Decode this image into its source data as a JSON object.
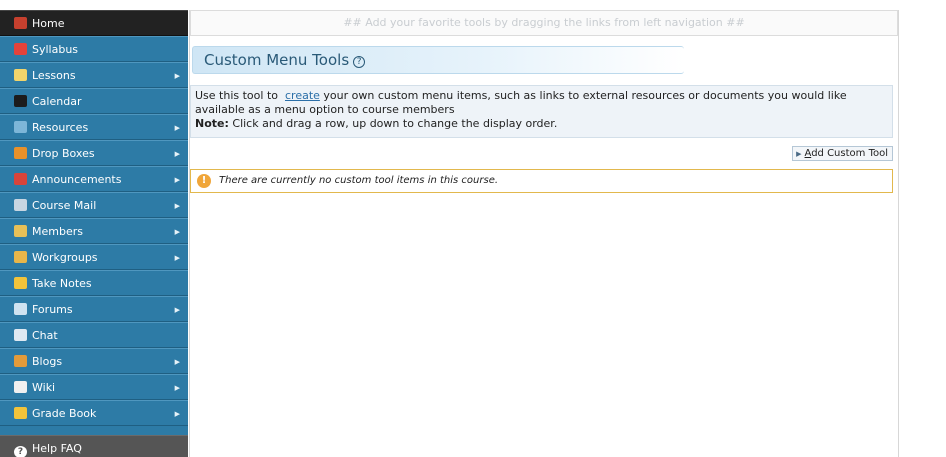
{
  "sidebar": {
    "items": [
      {
        "label": "Home",
        "icon": "home-icon",
        "color": "#c6402e",
        "submenu": false
      },
      {
        "label": "Syllabus",
        "icon": "books-icon",
        "color": "#e4423a",
        "submenu": false
      },
      {
        "label": "Lessons",
        "icon": "lessons-icon",
        "color": "#f2d56b",
        "submenu": true
      },
      {
        "label": "Calendar",
        "icon": "calendar-icon",
        "color": "#1c1c1c",
        "submenu": false
      },
      {
        "label": "Resources",
        "icon": "resources-icon",
        "color": "#7db6d8",
        "submenu": true
      },
      {
        "label": "Drop Boxes",
        "icon": "dropbox-icon",
        "color": "#e8912a",
        "submenu": true
      },
      {
        "label": "Announcements",
        "icon": "announcements-icon",
        "color": "#d8443a",
        "submenu": true
      },
      {
        "label": "Course Mail",
        "icon": "mail-icon",
        "color": "#c8d6e2",
        "submenu": true
      },
      {
        "label": "Members",
        "icon": "members-icon",
        "color": "#e7c058",
        "submenu": true
      },
      {
        "label": "Workgroups",
        "icon": "workgroups-icon",
        "color": "#e8b64a",
        "submenu": true
      },
      {
        "label": "Take Notes",
        "icon": "notes-icon",
        "color": "#f2c33a",
        "submenu": false
      },
      {
        "label": "Forums",
        "icon": "forums-icon",
        "color": "#cfe3f1",
        "submenu": true
      },
      {
        "label": "Chat",
        "icon": "chat-icon",
        "color": "#dfe9f2",
        "submenu": false
      },
      {
        "label": "Blogs",
        "icon": "blogs-icon",
        "color": "#e39b3a",
        "submenu": true
      },
      {
        "label": "Wiki",
        "icon": "wiki-icon",
        "color": "#f0f0f0",
        "submenu": true
      },
      {
        "label": "Grade Book",
        "icon": "gradebook-icon",
        "color": "#f2c33a",
        "submenu": true
      }
    ],
    "help": {
      "label": "Help FAQ",
      "icon": "help-icon",
      "color": "#ffffff"
    }
  },
  "main": {
    "favorites_bar": "## Add your favorite tools by dragging the links from left navigation ##",
    "title": "Custom Menu Tools",
    "help_glyph": "?",
    "info": {
      "prefix": "Use this tool to",
      "link": "create",
      "suffix": "your own custom menu items, such as links to external resources or documents you would like available as a menu option to course members",
      "note_label": "Note:",
      "note_text": "Click and drag a row, up down to change the display order."
    },
    "add_button": {
      "access_key": "A",
      "rest": "dd Custom Tool"
    },
    "warning": {
      "glyph": "!",
      "text": "There are currently no custom tool items in this course."
    }
  }
}
